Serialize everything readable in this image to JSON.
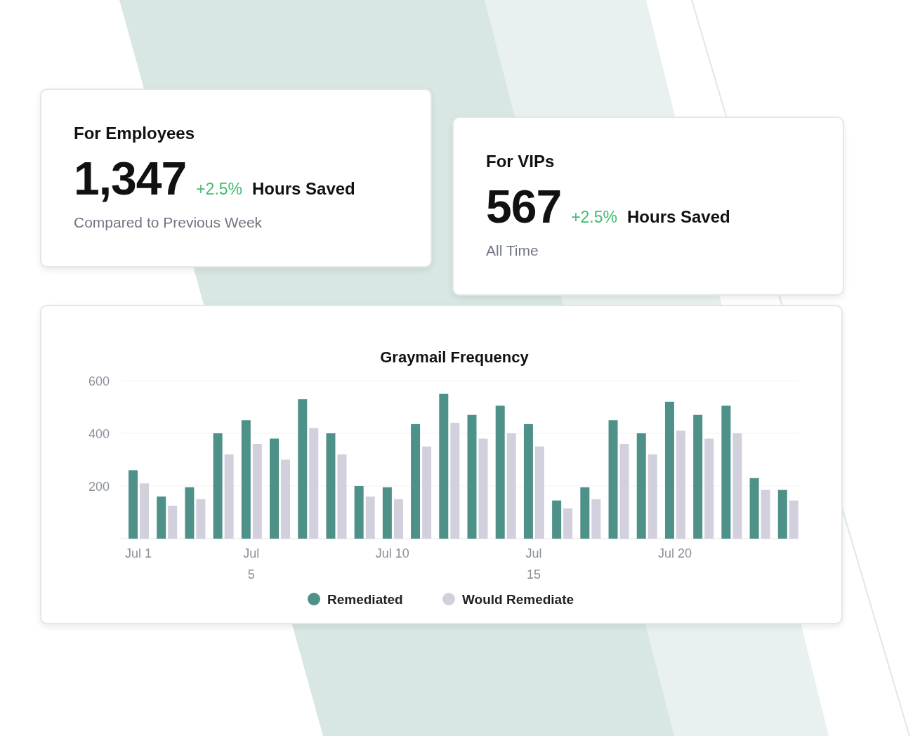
{
  "stat_cards": [
    {
      "title": "For Employees",
      "value": "1,347",
      "change": "+2.5%",
      "unit": "Hours Saved",
      "caption": "Compared to Previous Week"
    },
    {
      "title": "For VIPs",
      "value": "567",
      "change": "+2.5%",
      "unit": "Hours Saved",
      "caption": "All Time"
    }
  ],
  "chart_card": {
    "chart_data": {
      "type": "bar",
      "title": "Graymail Frequency",
      "categories": [
        "Jul 1",
        null,
        null,
        null,
        "Jul 5",
        null,
        null,
        null,
        null,
        "Jul 10",
        null,
        null,
        null,
        null,
        "Jul 15",
        null,
        null,
        null,
        null,
        "Jul 20",
        null,
        null,
        null,
        null
      ],
      "stacked": false,
      "series": [
        {
          "name": "Remediated",
          "color": "#4e9189",
          "values": [
            260,
            160,
            195,
            400,
            450,
            380,
            530,
            400,
            200,
            195,
            435,
            550,
            470,
            505,
            435,
            145,
            195,
            450,
            400,
            520,
            470,
            505,
            230,
            185
          ]
        },
        {
          "name": "Would Remediate",
          "color": "#d3d0de",
          "values": [
            210,
            125,
            150,
            320,
            360,
            300,
            420,
            320,
            160,
            150,
            350,
            440,
            380,
            400,
            350,
            115,
            150,
            360,
            320,
            410,
            380,
            400,
            185,
            145
          ]
        }
      ],
      "ylim": [
        0,
        600
      ],
      "yticks": [
        200,
        400,
        600
      ],
      "legend": "bottom"
    }
  }
}
